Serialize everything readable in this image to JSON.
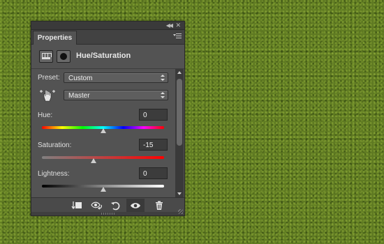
{
  "panel": {
    "tab_label": "Properties",
    "adjustment_title": "Hue/Saturation"
  },
  "preset": {
    "label": "Preset:",
    "value": "Custom"
  },
  "channel": {
    "value": "Master"
  },
  "hue": {
    "label": "Hue:",
    "value": "0",
    "slider_fraction": 0.5
  },
  "saturation": {
    "label": "Saturation:",
    "value": "-15",
    "slider_fraction": 0.425
  },
  "lightness": {
    "label": "Lightness:",
    "value": "0",
    "slider_fraction": 0.5
  },
  "colors": {
    "panel_bg": "#535353",
    "text": "#e0e0e0"
  },
  "icons": {
    "adjustment": "hue-saturation-adjustment-icon",
    "mask": "layer-mask-icon",
    "targeted_adjust": "targeted-adjustment-hand-icon",
    "clip": "clip-to-layer-icon",
    "view_previous": "view-previous-state-icon",
    "reset": "reset-icon",
    "visibility": "eye-icon",
    "delete": "trash-icon"
  }
}
